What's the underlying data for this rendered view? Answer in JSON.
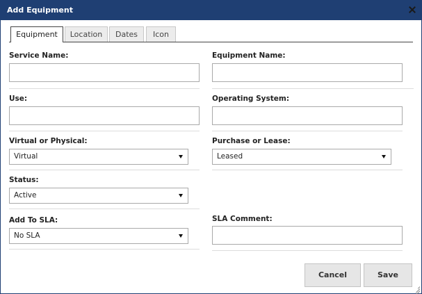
{
  "dialog": {
    "title": "Add Equipment"
  },
  "tabs": [
    {
      "label": "Equipment",
      "active": true
    },
    {
      "label": "Location",
      "active": false
    },
    {
      "label": "Dates",
      "active": false
    },
    {
      "label": "Icon",
      "active": false
    }
  ],
  "fields": {
    "service_name": {
      "label": "Service Name:",
      "value": ""
    },
    "equipment_name": {
      "label": "Equipment Name:",
      "value": ""
    },
    "use": {
      "label": "Use:",
      "value": ""
    },
    "operating_system": {
      "label": "Operating System:",
      "value": ""
    },
    "virtual_or_physical": {
      "label": "Virtual or Physical:",
      "value": "Virtual"
    },
    "purchase_or_lease": {
      "label": "Purchase or Lease:",
      "value": "Leased"
    },
    "status": {
      "label": "Status:",
      "value": "Active"
    },
    "add_to_sla": {
      "label": "Add To SLA:",
      "value": "No SLA"
    },
    "sla_comment": {
      "label": "SLA Comment:",
      "value": ""
    }
  },
  "buttons": {
    "cancel": "Cancel",
    "save": "Save"
  },
  "icons": {
    "close": "close-icon",
    "dropdown": "chevron-down-icon",
    "resize": "resize-grip-icon"
  },
  "colors": {
    "titlebar": "#1f3f73",
    "button": "#e6e6e6"
  }
}
